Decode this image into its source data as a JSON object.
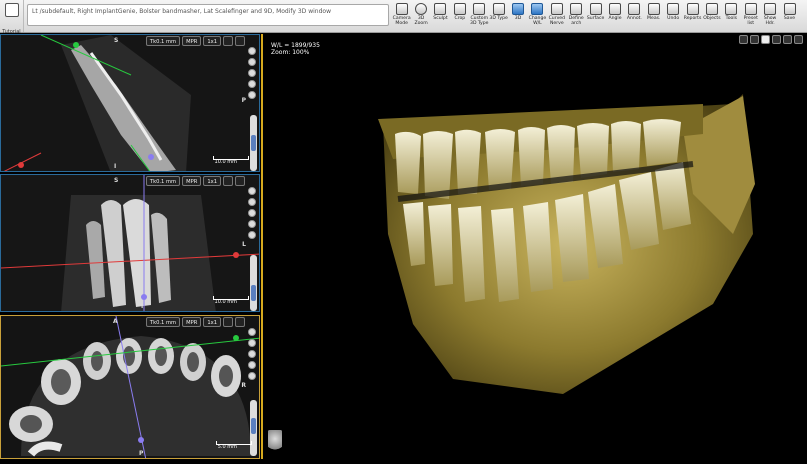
{
  "toolbar": {
    "left_label": "Tutorial",
    "title": "Lt /subdefault, Right ImplantGenie, Bolster bandmasher, Lat Scalefinger and 9D, Modify 3D window",
    "tools": [
      {
        "label": "Camera Mode",
        "icon": "camera-icon"
      },
      {
        "label": "3D Zoom",
        "icon": "zoom-icon"
      },
      {
        "label": "Sculpt",
        "icon": "sculpt-icon"
      },
      {
        "label": "Crop",
        "icon": "crop-icon"
      },
      {
        "label": "Custom 3D Type",
        "icon": "type-icon"
      },
      {
        "label": "3D Type",
        "icon": "3d-type-icon"
      },
      {
        "label": "3D",
        "icon": "3d-icon"
      },
      {
        "label": "Change W/L",
        "icon": "contrast-icon"
      },
      {
        "label": "Curved Nerve",
        "icon": "nerve-icon"
      },
      {
        "label": "Define arch",
        "icon": "arch-icon"
      },
      {
        "label": "Surface",
        "icon": "surface-icon"
      },
      {
        "label": "Angle",
        "icon": "angle-icon"
      },
      {
        "label": "Annot.",
        "icon": "annotate-icon"
      },
      {
        "label": "Meas.",
        "icon": "measure-icon"
      },
      {
        "label": "Undo",
        "icon": "undo-icon"
      },
      {
        "label": "Reports",
        "icon": "reports-icon"
      },
      {
        "label": "Objects",
        "icon": "objects-icon"
      },
      {
        "label": "Tools",
        "icon": "tools-icon"
      },
      {
        "label": "Preset list",
        "icon": "preset-icon"
      },
      {
        "label": "Show Hdr.",
        "icon": "header-icon"
      },
      {
        "label": "Save",
        "icon": "save-icon"
      }
    ]
  },
  "panes": [
    {
      "id": "sagittal",
      "mode": "1x1",
      "mpr": "MPR",
      "thick": "Tk0.1 mm",
      "scale": "10.0 mm",
      "ori_top": "S",
      "ori_right": "P",
      "ori_bottom": "I",
      "border": "#2a6a9a"
    },
    {
      "id": "coronal",
      "mode": "1x1",
      "mpr": "MPR",
      "thick": "Tk0.1 mm",
      "scale": "10.0 mm",
      "ori_top": "S",
      "ori_right": "L",
      "ori_bottom": "I",
      "border": "#2a6a9a"
    },
    {
      "id": "axial",
      "mode": "1x1",
      "mpr": "MPR",
      "thick": "Tk0.1 mm",
      "scale": "5.0 mm",
      "ori_top": "A",
      "ori_right": "R",
      "ori_bottom": "P",
      "border": "#c9a13a"
    }
  ],
  "view3d": {
    "wl_line1": "W/L = 1899/935",
    "wl_line2": "Zoom: 100%"
  },
  "colors": {
    "accent": "#d6a91e",
    "pane_border": "#2a6a9a",
    "crosshair_green": "#27c93f",
    "crosshair_red": "#e03a3a",
    "crosshair_purple": "#8a7cf0"
  }
}
